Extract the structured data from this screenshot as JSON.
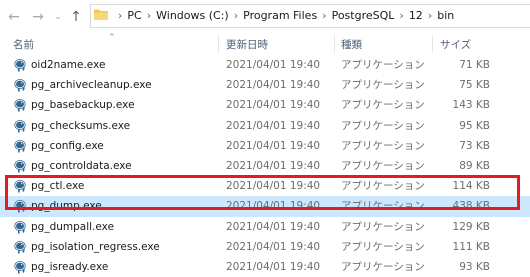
{
  "nav": {
    "back_icon": "arrow-left-icon",
    "forward_icon": "arrow-right-icon",
    "recent_icon": "chevron-down-icon",
    "up_icon": "arrow-up-icon"
  },
  "breadcrumb": [
    "PC",
    "Windows (C:)",
    "Program Files",
    "PostgreSQL",
    "12",
    "bin"
  ],
  "columns": {
    "name": "名前",
    "date": "更新日時",
    "type": "種類",
    "size": "サイズ"
  },
  "files": [
    {
      "name": "oid2name.exe",
      "date": "2021/04/01 19:40",
      "type": "アプリケーション",
      "size": "71 KB",
      "selected": false
    },
    {
      "name": "pg_archivecleanup.exe",
      "date": "2021/04/01 19:40",
      "type": "アプリケーション",
      "size": "75 KB",
      "selected": false
    },
    {
      "name": "pg_basebackup.exe",
      "date": "2021/04/01 19:40",
      "type": "アプリケーション",
      "size": "143 KB",
      "selected": false
    },
    {
      "name": "pg_checksums.exe",
      "date": "2021/04/01 19:40",
      "type": "アプリケーション",
      "size": "95 KB",
      "selected": false
    },
    {
      "name": "pg_config.exe",
      "date": "2021/04/01 19:40",
      "type": "アプリケーション",
      "size": "73 KB",
      "selected": false
    },
    {
      "name": "pg_controldata.exe",
      "date": "2021/04/01 19:40",
      "type": "アプリケーション",
      "size": "89 KB",
      "selected": false
    },
    {
      "name": "pg_ctl.exe",
      "date": "2021/04/01 19:40",
      "type": "アプリケーション",
      "size": "114 KB",
      "selected": false
    },
    {
      "name": "pg_dump.exe",
      "date": "2021/04/01 19:40",
      "type": "アプリケーション",
      "size": "438 KB",
      "selected": true
    },
    {
      "name": "pg_dumpall.exe",
      "date": "2021/04/01 19:40",
      "type": "アプリケーション",
      "size": "129 KB",
      "selected": false
    },
    {
      "name": "pg_isolation_regress.exe",
      "date": "2021/04/01 19:40",
      "type": "アプリケーション",
      "size": "111 KB",
      "selected": false
    },
    {
      "name": "pg_isready.exe",
      "date": "2021/04/01 19:40",
      "type": "アプリケーション",
      "size": "93 KB",
      "selected": false
    }
  ],
  "colors": {
    "selection": "#cce8ff",
    "highlight_border": "#e31b23",
    "folder": "#f2c94c",
    "elephant": "#336791"
  }
}
